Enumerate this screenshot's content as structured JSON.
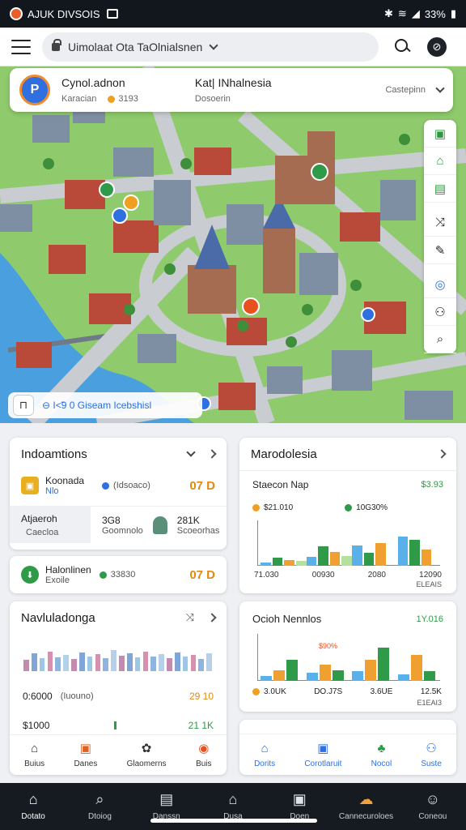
{
  "status_bar": {
    "app_name": "AJUK DIVSOIS",
    "right": "33%"
  },
  "top_bar": {
    "address_text": "Uimolaat Ota TaOlnialsnen",
    "compass_glyph": "⊘"
  },
  "map_card": {
    "title": "Cynol.adnon",
    "subtitle": "Karacian",
    "pill_value": "3193",
    "title2": "Kat| INhalnesia",
    "subtitle2": "Dosoerin",
    "right_label": "Castepinn",
    "logo_letter": "P"
  },
  "map_tools": [
    "▣",
    "⌂",
    "▤",
    "⤨",
    "✎",
    "◎",
    "⚇",
    "⌕"
  ],
  "map_bottom": {
    "layer_glyph": "⊓",
    "text": "⊖ I<̃9 0  Giseam Icebshisl"
  },
  "indoamenns": {
    "title": "Indoamtions",
    "row1": {
      "name": "Koonada",
      "sub": "Nlo",
      "pill": "(Idsoaco)",
      "value": "07 D"
    },
    "row2": {
      "a_title": "Atjaeroh",
      "a_sub": "Caecloa",
      "b_title": "3G8",
      "b_sub": "Goomnolo",
      "c_title": "281K",
      "c_sub": "Scoeorhas"
    }
  },
  "halontien": {
    "title": "Halonlinen",
    "sub": "Exoile",
    "mid": "33830",
    "value": "07 D"
  },
  "marodolesia": {
    "title": "Marodolesia",
    "subtitle": "Staecon Nap",
    "sub_value": "$3.93",
    "legend": [
      {
        "label": "$21.010",
        "color": "#f0a020"
      },
      {
        "label": "10G30%",
        "color": "#2f9a48"
      }
    ],
    "chart_labels": [
      "71.030",
      "00930",
      "2080",
      "12090"
    ],
    "foot": "ELEAIS"
  },
  "navluladonga": {
    "title": "Navluladonga",
    "line1_left": "0:6000",
    "line1_mid": "(Iuouno)",
    "line1_right": "29 10",
    "line2_left": "$1000",
    "line2_right": "21 1K",
    "tabs": [
      {
        "glyph": "⌂",
        "label": "Buius"
      },
      {
        "glyph": "▣",
        "label": "Danes"
      },
      {
        "glyph": "✿",
        "label": "Glaomerns"
      },
      {
        "glyph": "◉",
        "label": "Buis"
      }
    ]
  },
  "ocion": {
    "title": "Ocioh Nennlos",
    "value": "1Y.016",
    "peak_label": "$90%",
    "foot_labels": [
      "3.0UK",
      "DO.J7S",
      "3.6UE",
      "12.5K"
    ],
    "foot2": "E1EAI3",
    "tabs": [
      {
        "glyph": "⌂",
        "label": "Dorits"
      },
      {
        "glyph": "▣",
        "label": "Corotlaruit"
      },
      {
        "glyph": "♣",
        "label": "Nocol"
      },
      {
        "glyph": "⚇",
        "label": "Suste"
      }
    ]
  },
  "bottom_nav": [
    {
      "glyph": "⌂",
      "label": "Dotato"
    },
    {
      "glyph": "⌕",
      "label": "Dtoiog"
    },
    {
      "glyph": "▤",
      "label": "Danssn"
    },
    {
      "glyph": "⌂",
      "label": "Dusa"
    },
    {
      "glyph": "▣",
      "label": "Doen"
    },
    {
      "glyph": "☁",
      "label": "Cannecuroloes"
    },
    {
      "glyph": "☺",
      "label": "Coneou"
    }
  ],
  "chart_data": [
    {
      "type": "bar",
      "title": "Staecon Nap",
      "series": [
        {
          "color": "#5ab0e8",
          "values": [
            8,
            20,
            45,
            65
          ]
        },
        {
          "color": "#2f9a48",
          "values": [
            18,
            42,
            28,
            58
          ]
        },
        {
          "color": "#f0a030",
          "values": [
            12,
            30,
            50,
            35
          ]
        },
        {
          "color": "#b5e0a0",
          "values": [
            10,
            22
          ]
        }
      ],
      "ylim": [
        0,
        100
      ]
    },
    {
      "type": "bar",
      "title": "Ocioh Nennlos",
      "series": [
        {
          "color": "#5ab0e8",
          "values": [
            10,
            18,
            20,
            14
          ]
        },
        {
          "color": "#f0a030",
          "values": [
            22,
            35,
            45,
            55
          ]
        },
        {
          "color": "#2f9a48",
          "values": [
            45,
            22,
            70,
            20
          ]
        }
      ],
      "ylim": [
        0,
        100
      ]
    },
    {
      "type": "bar",
      "title": "Navluladonga",
      "values": [
        35,
        55,
        40,
        60,
        42,
        50,
        38,
        58,
        45,
        52,
        40,
        65,
        48,
        55,
        42,
        60,
        45,
        52,
        40,
        58,
        45,
        50,
        38,
        55
      ],
      "ylim": [
        0,
        100
      ]
    }
  ]
}
